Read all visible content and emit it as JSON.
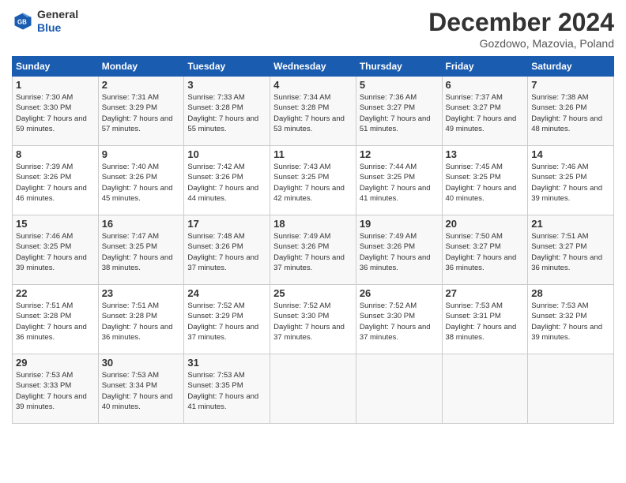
{
  "header": {
    "logo": {
      "line1": "General",
      "line2": "Blue"
    },
    "title": "December 2024",
    "location": "Gozdowo, Mazovia, Poland"
  },
  "weekdays": [
    "Sunday",
    "Monday",
    "Tuesday",
    "Wednesday",
    "Thursday",
    "Friday",
    "Saturday"
  ],
  "weeks": [
    [
      {
        "day": "1",
        "sunrise": "7:30 AM",
        "sunset": "3:30 PM",
        "daylight": "7 hours and 59 minutes."
      },
      {
        "day": "2",
        "sunrise": "7:31 AM",
        "sunset": "3:29 PM",
        "daylight": "7 hours and 57 minutes."
      },
      {
        "day": "3",
        "sunrise": "7:33 AM",
        "sunset": "3:28 PM",
        "daylight": "7 hours and 55 minutes."
      },
      {
        "day": "4",
        "sunrise": "7:34 AM",
        "sunset": "3:28 PM",
        "daylight": "7 hours and 53 minutes."
      },
      {
        "day": "5",
        "sunrise": "7:36 AM",
        "sunset": "3:27 PM",
        "daylight": "7 hours and 51 minutes."
      },
      {
        "day": "6",
        "sunrise": "7:37 AM",
        "sunset": "3:27 PM",
        "daylight": "7 hours and 49 minutes."
      },
      {
        "day": "7",
        "sunrise": "7:38 AM",
        "sunset": "3:26 PM",
        "daylight": "7 hours and 48 minutes."
      }
    ],
    [
      {
        "day": "8",
        "sunrise": "7:39 AM",
        "sunset": "3:26 PM",
        "daylight": "7 hours and 46 minutes."
      },
      {
        "day": "9",
        "sunrise": "7:40 AM",
        "sunset": "3:26 PM",
        "daylight": "7 hours and 45 minutes."
      },
      {
        "day": "10",
        "sunrise": "7:42 AM",
        "sunset": "3:26 PM",
        "daylight": "7 hours and 44 minutes."
      },
      {
        "day": "11",
        "sunrise": "7:43 AM",
        "sunset": "3:25 PM",
        "daylight": "7 hours and 42 minutes."
      },
      {
        "day": "12",
        "sunrise": "7:44 AM",
        "sunset": "3:25 PM",
        "daylight": "7 hours and 41 minutes."
      },
      {
        "day": "13",
        "sunrise": "7:45 AM",
        "sunset": "3:25 PM",
        "daylight": "7 hours and 40 minutes."
      },
      {
        "day": "14",
        "sunrise": "7:46 AM",
        "sunset": "3:25 PM",
        "daylight": "7 hours and 39 minutes."
      }
    ],
    [
      {
        "day": "15",
        "sunrise": "7:46 AM",
        "sunset": "3:25 PM",
        "daylight": "7 hours and 39 minutes."
      },
      {
        "day": "16",
        "sunrise": "7:47 AM",
        "sunset": "3:25 PM",
        "daylight": "7 hours and 38 minutes."
      },
      {
        "day": "17",
        "sunrise": "7:48 AM",
        "sunset": "3:26 PM",
        "daylight": "7 hours and 37 minutes."
      },
      {
        "day": "18",
        "sunrise": "7:49 AM",
        "sunset": "3:26 PM",
        "daylight": "7 hours and 37 minutes."
      },
      {
        "day": "19",
        "sunrise": "7:49 AM",
        "sunset": "3:26 PM",
        "daylight": "7 hours and 36 minutes."
      },
      {
        "day": "20",
        "sunrise": "7:50 AM",
        "sunset": "3:27 PM",
        "daylight": "7 hours and 36 minutes."
      },
      {
        "day": "21",
        "sunrise": "7:51 AM",
        "sunset": "3:27 PM",
        "daylight": "7 hours and 36 minutes."
      }
    ],
    [
      {
        "day": "22",
        "sunrise": "7:51 AM",
        "sunset": "3:28 PM",
        "daylight": "7 hours and 36 minutes."
      },
      {
        "day": "23",
        "sunrise": "7:51 AM",
        "sunset": "3:28 PM",
        "daylight": "7 hours and 36 minutes."
      },
      {
        "day": "24",
        "sunrise": "7:52 AM",
        "sunset": "3:29 PM",
        "daylight": "7 hours and 37 minutes."
      },
      {
        "day": "25",
        "sunrise": "7:52 AM",
        "sunset": "3:30 PM",
        "daylight": "7 hours and 37 minutes."
      },
      {
        "day": "26",
        "sunrise": "7:52 AM",
        "sunset": "3:30 PM",
        "daylight": "7 hours and 37 minutes."
      },
      {
        "day": "27",
        "sunrise": "7:53 AM",
        "sunset": "3:31 PM",
        "daylight": "7 hours and 38 minutes."
      },
      {
        "day": "28",
        "sunrise": "7:53 AM",
        "sunset": "3:32 PM",
        "daylight": "7 hours and 39 minutes."
      }
    ],
    [
      {
        "day": "29",
        "sunrise": "7:53 AM",
        "sunset": "3:33 PM",
        "daylight": "7 hours and 39 minutes."
      },
      {
        "day": "30",
        "sunrise": "7:53 AM",
        "sunset": "3:34 PM",
        "daylight": "7 hours and 40 minutes."
      },
      {
        "day": "31",
        "sunrise": "7:53 AM",
        "sunset": "3:35 PM",
        "daylight": "7 hours and 41 minutes."
      },
      null,
      null,
      null,
      null
    ]
  ]
}
